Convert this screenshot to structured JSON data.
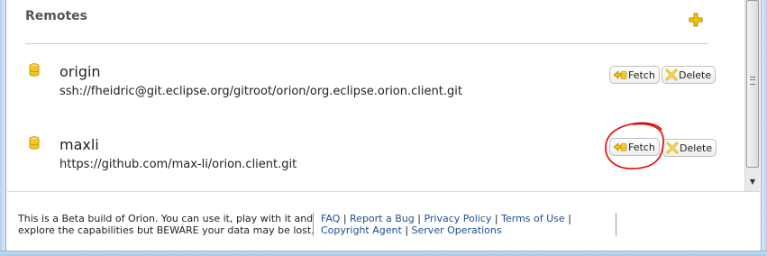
{
  "section": {
    "title": "Remotes",
    "add_icon": "plus-icon",
    "accent_color": "#e8b400"
  },
  "remotes": [
    {
      "name": "origin",
      "url": "ssh://fheidric@git.eclipse.org/gitroot/orion/org.eclipse.orion.client.git",
      "icon": "repository-icon",
      "fetch_label": "Fetch",
      "delete_label": "Delete"
    },
    {
      "name": "maxli",
      "url": "https://github.com/max-li/orion.client.git",
      "icon": "repository-icon",
      "fetch_label": "Fetch",
      "delete_label": "Delete"
    }
  ],
  "footer": {
    "notice": "This is a Beta build of Orion. You can use it, play with it and explore the capabilities but BEWARE your data may be lost.",
    "links": {
      "faq": "FAQ",
      "report_bug": "Report a Bug",
      "privacy": "Privacy Policy",
      "terms": "Terms of Use",
      "copyright": "Copyright Agent",
      "server_ops": "Server Operations"
    },
    "link_color": "#1d4f91"
  },
  "annotation": {
    "color": "#e00000"
  }
}
